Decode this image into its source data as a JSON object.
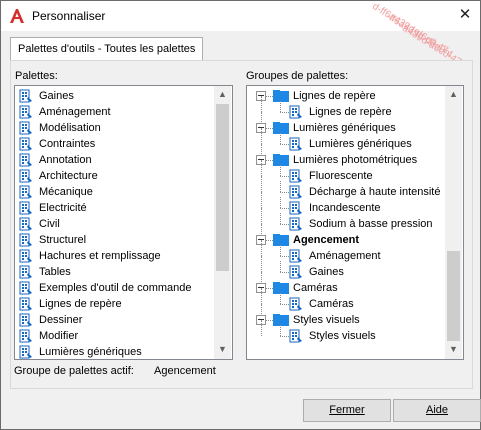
{
  "window": {
    "title": "Personnaliser",
    "close_glyph": "✕"
  },
  "watermark": [
    "d-ff6a439d-d6c0-47",
    "-ff6a439d-d6c0-4",
    "a439d-d6c0-476"
  ],
  "tab": {
    "label": "Palettes d'outils - Toutes les palettes"
  },
  "palettes": {
    "label": "Palettes:",
    "items": [
      "Gaines",
      "Aménagement",
      "Modélisation",
      "Contraintes",
      "Annotation",
      "Architecture",
      "Mécanique",
      "Electricité",
      "Civil",
      "Structurel",
      "Hachures et remplissage",
      "Tables",
      "Exemples d'outil de commande",
      "Lignes de repère",
      "Dessiner",
      "Modifier",
      "Lumières génériques"
    ]
  },
  "groups": {
    "label": "Groupes de palettes:",
    "tree": [
      {
        "label": "Lignes de repère",
        "level": 0,
        "type": "group",
        "bold": false
      },
      {
        "label": "Lignes de repère",
        "level": 1,
        "type": "palette",
        "bold": false
      },
      {
        "label": "Lumières génériques",
        "level": 0,
        "type": "group",
        "bold": false
      },
      {
        "label": "Lumières génériques",
        "level": 1,
        "type": "palette",
        "bold": false
      },
      {
        "label": "Lumières photométriques",
        "level": 0,
        "type": "group",
        "bold": false
      },
      {
        "label": "Fluorescente",
        "level": 1,
        "type": "palette",
        "bold": false
      },
      {
        "label": "Décharge à haute intensité",
        "level": 1,
        "type": "palette",
        "bold": false
      },
      {
        "label": "Incandescente",
        "level": 1,
        "type": "palette",
        "bold": false
      },
      {
        "label": "Sodium à basse pression",
        "level": 1,
        "type": "palette",
        "bold": false
      },
      {
        "label": "Agencement",
        "level": 0,
        "type": "group",
        "bold": true
      },
      {
        "label": "Aménagement",
        "level": 1,
        "type": "palette",
        "bold": false
      },
      {
        "label": "Gaines",
        "level": 1,
        "type": "palette",
        "bold": false
      },
      {
        "label": "Caméras",
        "level": 0,
        "type": "group",
        "bold": false
      },
      {
        "label": "Caméras",
        "level": 1,
        "type": "palette",
        "bold": false
      },
      {
        "label": "Styles visuels",
        "level": 0,
        "type": "group",
        "bold": false
      },
      {
        "label": "Styles visuels",
        "level": 1,
        "type": "palette",
        "bold": false
      }
    ]
  },
  "active_group": {
    "label": "Groupe de palettes actif:",
    "value": "Agencement"
  },
  "buttons": {
    "close": "Fermer",
    "help": "Aide"
  },
  "colors": {
    "folder": "#1e88e5",
    "accent_red": "#d32f2f"
  }
}
